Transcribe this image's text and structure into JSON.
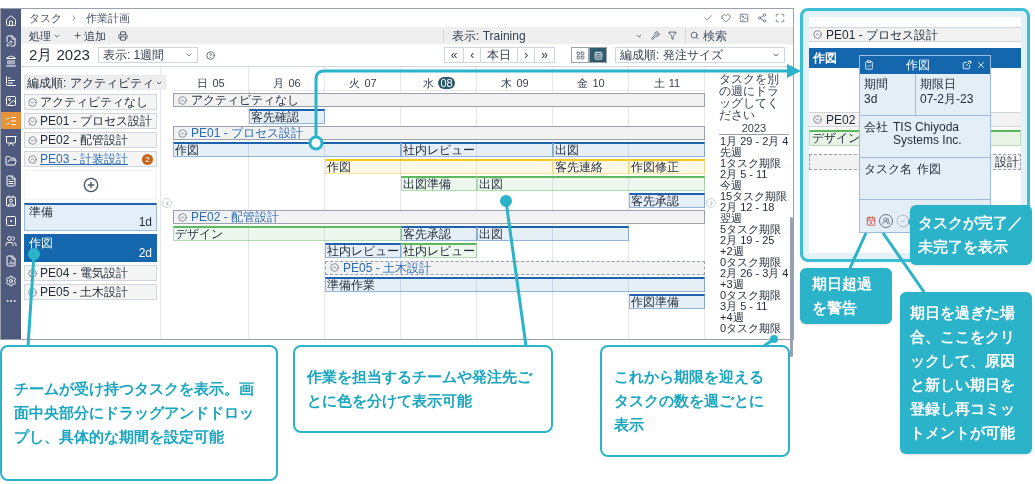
{
  "nav_items": [
    {
      "selected": false
    },
    {
      "selected": false
    },
    {
      "selected": false
    },
    {
      "selected": false
    },
    {
      "selected": false
    },
    {
      "selected": true
    },
    {
      "selected": false
    },
    {
      "selected": false
    },
    {
      "selected": false
    },
    {
      "selected": false
    },
    {
      "selected": false
    },
    {
      "selected": false
    },
    {
      "selected": false
    },
    {
      "selected": false
    },
    {
      "selected": false
    }
  ],
  "breadcrumb": [
    "タスク",
    "作業計画"
  ],
  "toolbar": {
    "actions": [
      {
        "kind": "menu",
        "label": "処理"
      },
      {
        "kind": "add",
        "label": "追加"
      },
      {
        "kind": "print"
      }
    ],
    "view_select": "表示: Training",
    "search": {
      "placeholder": "検索"
    }
  },
  "header": {
    "title": "2月 2023",
    "range_select": "表示: 1週間",
    "nav": [
      "«",
      "‹",
      "本日",
      "›",
      "»"
    ],
    "views": [
      {
        "selected": false
      },
      {
        "selected": true
      }
    ],
    "sort_select": "編成順: 発注サイズ"
  },
  "sidebar": {
    "sort_button": "編成順: アクティビティ",
    "groups": [
      {
        "label": "アクティビティなし",
        "expanded": false
      },
      {
        "label": "PE01 - プロセス設計",
        "expanded": false
      },
      {
        "label": "PE02 - 配管設計",
        "expanded": false
      },
      {
        "label": "PE03 - 計装設計",
        "expanded": true,
        "badge": "2",
        "tasks": [
          {
            "label": "準備",
            "duration": "1d",
            "selected": false
          },
          {
            "label": "作図",
            "duration": "2d",
            "selected": true
          }
        ]
      },
      {
        "label": "PE04 - 電気設計",
        "expanded": false
      },
      {
        "label": "PE05 - 土木設計",
        "expanded": false
      }
    ]
  },
  "gantt": {
    "days": [
      {
        "weekday": "日",
        "date": "05",
        "today": false
      },
      {
        "weekday": "月",
        "date": "06",
        "today": false
      },
      {
        "weekday": "火",
        "date": "07",
        "today": false
      },
      {
        "weekday": "水",
        "date": "08",
        "today": true
      },
      {
        "weekday": "木",
        "date": "09",
        "today": false
      },
      {
        "weekday": "金",
        "date": "10",
        "today": false
      },
      {
        "weekday": "土",
        "date": "11",
        "today": false
      }
    ],
    "rows": [
      {
        "kind": "group",
        "label": "アクティビティなし",
        "linked": false
      },
      {
        "kind": "lane",
        "slots": [
          {
            "kind": "gap"
          },
          {
            "kind": "task",
            "label": "客先確認",
            "color": "#1f62ad"
          },
          {
            "kind": "gap"
          },
          {
            "kind": "gap"
          },
          {
            "kind": "gap"
          },
          {
            "kind": "gap"
          },
          {
            "kind": "gap"
          }
        ]
      },
      {
        "kind": "group",
        "label": "PE01 - プロセス設計",
        "linked": true
      },
      {
        "kind": "lane",
        "slots": [
          {
            "kind": "task",
            "label": "作図",
            "color": "#1f62ad"
          },
          {
            "kind": "continued"
          },
          {
            "kind": "continued"
          },
          {
            "kind": "task",
            "label": "社内レビュー",
            "color": "#1f62ad"
          },
          {
            "kind": "continued"
          },
          {
            "kind": "task",
            "label": "出図",
            "color": "#1f62ad"
          },
          {
            "kind": "continued"
          }
        ]
      },
      {
        "kind": "lane",
        "slots": [
          {
            "kind": "gap"
          },
          {
            "kind": "gap"
          },
          {
            "kind": "task",
            "label": "作図",
            "color": "#f2c81b"
          },
          {
            "kind": "continued"
          },
          {
            "kind": "continued"
          },
          {
            "kind": "task",
            "label": "客先連絡",
            "color": "#f2c81b"
          },
          {
            "kind": "task",
            "label": "作図修正",
            "color": "#f2c81b"
          }
        ]
      },
      {
        "kind": "lane",
        "slots": [
          {
            "kind": "gap"
          },
          {
            "kind": "gap"
          },
          {
            "kind": "gap"
          },
          {
            "kind": "task",
            "label": "出図準備",
            "color": "#5cb85c"
          },
          {
            "kind": "task",
            "label": "出図",
            "color": "#5cb85c"
          },
          {
            "kind": "continued"
          },
          {
            "kind": "continued"
          }
        ]
      },
      {
        "kind": "lane",
        "slots": [
          {
            "kind": "gap"
          },
          {
            "kind": "gap"
          },
          {
            "kind": "gap"
          },
          {
            "kind": "gap"
          },
          {
            "kind": "gap"
          },
          {
            "kind": "gap"
          },
          {
            "kind": "task",
            "label": "客先承認",
            "color": "#1f62ad"
          }
        ]
      },
      {
        "kind": "group",
        "label": "PE02 - 配管設計",
        "linked": true
      },
      {
        "kind": "lane",
        "slots": [
          {
            "kind": "task",
            "label": "デザイン",
            "color": "#5cb85c"
          },
          {
            "kind": "continued"
          },
          {
            "kind": "continued"
          },
          {
            "kind": "task",
            "label": "客先承認",
            "color": "#1f62ad"
          },
          {
            "kind": "task",
            "label": "出図",
            "color": "#1f62ad"
          },
          {
            "kind": "continued"
          },
          {
            "kind": "gap"
          }
        ]
      },
      {
        "kind": "lane",
        "slots": [
          {
            "kind": "gap"
          },
          {
            "kind": "gap"
          },
          {
            "kind": "task",
            "label": "社内レビュー",
            "color": "#1f62ad"
          },
          {
            "kind": "task",
            "label": "社内レビュー",
            "color": "#5cb85c"
          },
          {
            "kind": "gap"
          },
          {
            "kind": "gap"
          },
          {
            "kind": "gap"
          }
        ]
      },
      {
        "kind": "lane",
        "slots": [
          {
            "kind": "gap"
          },
          {
            "kind": "gap"
          },
          {
            "kind": "group",
            "label": "PE05 - 土木設計",
            "linked": true
          },
          {
            "kind": "continued"
          },
          {
            "kind": "continued"
          },
          {
            "kind": "continued"
          },
          {
            "kind": "continued"
          }
        ]
      },
      {
        "kind": "lane",
        "slots": [
          {
            "kind": "gap"
          },
          {
            "kind": "gap"
          },
          {
            "kind": "task",
            "label": "準備作業",
            "color": "#1f62ad"
          },
          {
            "kind": "continued"
          },
          {
            "kind": "continued"
          },
          {
            "kind": "continued"
          },
          {
            "kind": "continued"
          }
        ]
      },
      {
        "kind": "lane",
        "slots": [
          {
            "kind": "gap"
          },
          {
            "kind": "gap"
          },
          {
            "kind": "gap"
          },
          {
            "kind": "gap"
          },
          {
            "kind": "gap"
          },
          {
            "kind": "gap"
          },
          {
            "kind": "task",
            "label": "作図準備",
            "color": "#1f62ad"
          }
        ]
      }
    ]
  },
  "weeks": {
    "hint": "タスクを別の週にドラッグしてください",
    "year": "2023",
    "items": [
      {
        "range": "1月 29 - 2月 4",
        "relative": "先週",
        "count": "1タスク期限"
      },
      {
        "range": "2月 5 - 11",
        "relative": "今週",
        "count": "15タスク期限"
      },
      {
        "range": "2月 12 - 18",
        "relative": "翌週",
        "count": "5タスク期限"
      },
      {
        "range": "2月 19 - 25",
        "relative": "+2週",
        "count": "0タスク期限"
      },
      {
        "range": "2月 26 - 3月 4",
        "relative": "+3週",
        "count": "0タスク期限"
      },
      {
        "range": "3月 5 - 11",
        "relative": "+4週",
        "count": "0タスク期限"
      }
    ]
  },
  "detail": {
    "group": "PE01 - プロセス設計",
    "bar": "作図",
    "behind_group": "PE02",
    "behind_bar": "デザイン",
    "behind_fragment": "設計",
    "popup": {
      "title": "作図",
      "fields": [
        {
          "label": "期間",
          "value": "3d"
        },
        {
          "label": "期限日",
          "value": "07-2月-23"
        },
        {
          "label": "会社",
          "value": "TIS Chiyoda Systems Inc."
        },
        {
          "label": "タスク名",
          "value": "作図"
        }
      ],
      "overdue": true,
      "completed": false
    }
  },
  "callouts": [
    {
      "kind": "outline",
      "text": "チームが受け持つタスクを表示。画面中央部分にドラッグアンドドロップし、具体的な期間を設定可能"
    },
    {
      "kind": "outline",
      "text": "作業を担当するチームや発注先ごとに色を分けて表示可能"
    },
    {
      "kind": "outline",
      "text": "これから期限を迎えるタスクの数を週ごとに表示"
    },
    {
      "kind": "filled",
      "text": "タスクが完了／未完了を表示"
    },
    {
      "kind": "filled",
      "text": "期日超過を警告"
    },
    {
      "kind": "filled",
      "text": "期日を過ぎた場合、ここをクリックして、原因と新しい期日を登録し再コミットメントが可能"
    }
  ]
}
